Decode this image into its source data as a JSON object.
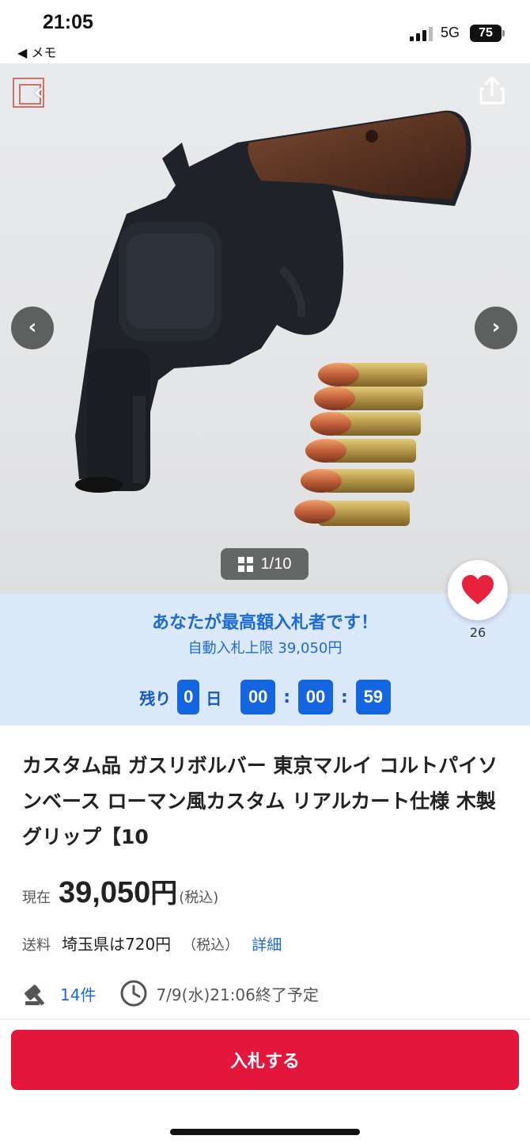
{
  "status_bar": {
    "time": "21:05",
    "back_app": "◀ メモ",
    "network": "5G",
    "battery": "75"
  },
  "gallery": {
    "counter": "1/10",
    "favorites": "26"
  },
  "bid_status": {
    "title": "あなたが最高額入札者です！",
    "auto_limit": "自動入札上限 39,050円",
    "remaining_label": "残り",
    "days": "0",
    "day_unit": "日",
    "hours": "00",
    "minutes": "00",
    "seconds": "59"
  },
  "item": {
    "title": "カスタム品 ガスリボルバー 東京マルイ コルトパイソンベース ローマン風カスタム リアルカート仕様 木製グリップ【10"
  },
  "price": {
    "label": "現在",
    "value": "39,050",
    "unit": "円",
    "tax": "(税込)"
  },
  "shipping": {
    "label": "送料",
    "value": "埼玉県は720円",
    "tax": "（税込）",
    "detail_link": "詳細"
  },
  "meta": {
    "bid_count": "14件",
    "end_time": "7/9(水)21:06終了予定"
  },
  "actions": {
    "bid_button": "入札する"
  },
  "colors": {
    "accent_blue": "#1b6ad8",
    "bid_red": "#e3163c",
    "banner_bg": "#dce9fb",
    "heart_red": "#e8213f"
  }
}
